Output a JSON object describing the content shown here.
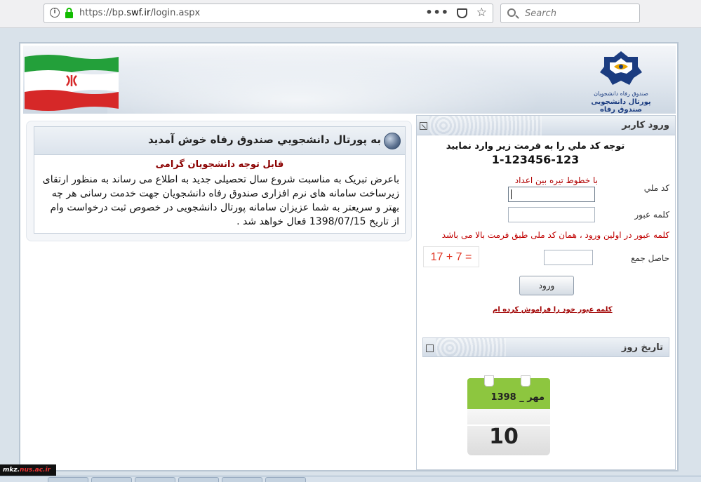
{
  "browser": {
    "url_prefix": "https://bp.",
    "url_domain": "swf.ir",
    "url_suffix": "/login.aspx",
    "search_placeholder": "Search",
    "menu_glyph": "•••",
    "star_glyph": "☆",
    "info_glyph": "i"
  },
  "header": {
    "logo_line1": "صندوق رفاه دانشجویان",
    "logo_line2": "پورتال دانشجویی صندوق رفاه"
  },
  "welcome": {
    "title": "به پورتال دانشجويي صندوق رفاه خوش آمديد",
    "subtitle": "قابل توجه دانشجويان گرامی",
    "message": "باعرض تبریک به مناسبت شروع سال تحصیلی جدید به اطلاع می رساند به منظور ارتقای زیرساخت سامانه های نرم افزاری صندوق رفاه دانشجویان جهت خدمت رسانی هر چه بهتر و سریعتر به شما عزیزان سامانه پورتال دانشجویی در خصوص ثبت درخواست وام از تاریخ 1398/07/15 فعال خواهد شد ."
  },
  "login": {
    "header": "ورود کاربر",
    "notice": "توجه کد ملي را به فرمت زير وارد نماييد",
    "format": "1-123456-123",
    "hint": "با خطوط تيره بين اعداد",
    "national_code_label": "کد ملي",
    "national_code_value": "",
    "password_label": "کلمه عبور",
    "password_value": "",
    "warning": "کلمه عبور در اولين ورود ، همان کد ملی طبق فرمت بالا می باشد",
    "captcha_label": "حاصل جمع",
    "captcha_text": "17 + 7 =",
    "captcha_value": "",
    "submit": "ورود",
    "forgot": "کلمه عبور خود را فراموش کرده ام"
  },
  "date": {
    "header": "تاريخ روز",
    "month_year": "مهر _ 1398",
    "day": "10"
  },
  "watermark": {
    "prefix": "mkz.",
    "domain": "nus.ac.ir"
  }
}
